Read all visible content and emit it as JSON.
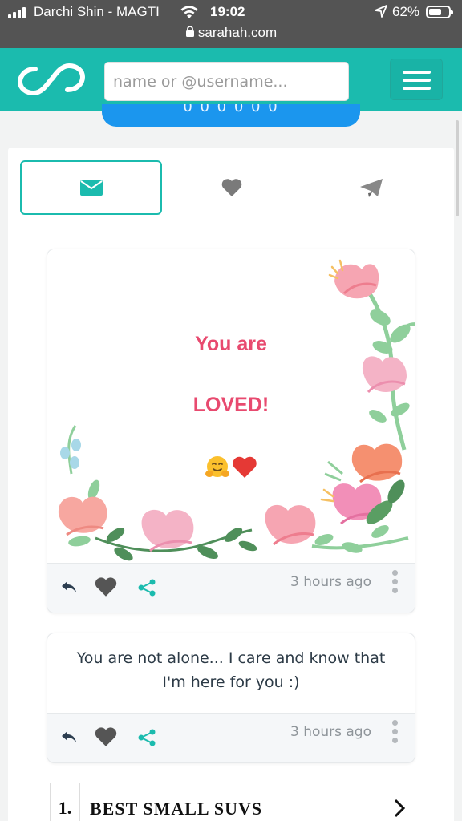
{
  "status_bar": {
    "carrier": "Darchi Shin - MAGTI",
    "time": "19:02",
    "battery_percent": "62%",
    "battery_level": 0.62,
    "url": "sarahah.com"
  },
  "header": {
    "search_placeholder": "name or @username...",
    "brand_color": "#1bbbae"
  },
  "tabs": [
    {
      "icon": "envelope-icon",
      "active": true
    },
    {
      "icon": "heart-icon",
      "active": false
    },
    {
      "icon": "paper-plane-icon",
      "active": false
    }
  ],
  "messages": [
    {
      "image_text_line1": "You are",
      "image_text_line2": "LOVED!",
      "image_emojis": "🤗❤️",
      "time": "3 hours ago"
    },
    {
      "text": "You are not alone... I care and know that I'm here for you :)",
      "time": "3 hours ago"
    }
  ],
  "ad": {
    "number": "1.",
    "title": "BEST SMALL SUVS"
  },
  "colors": {
    "accent": "#1bbbae",
    "button_blue": "#1b96ee",
    "text_pink": "#e84a6f"
  }
}
